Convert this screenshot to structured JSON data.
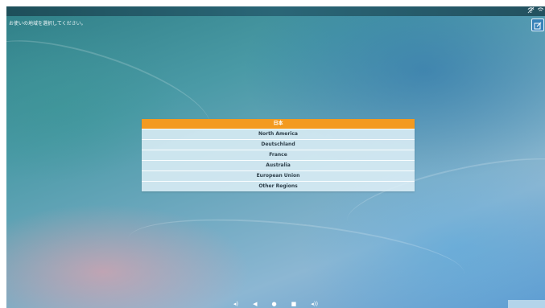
{
  "prompt_text": "お使いの地域を選択してください。",
  "status_bar": {
    "icons": [
      "wifi-off-icon",
      "wifi-icon"
    ]
  },
  "edit_button": {
    "icon": "edit-icon"
  },
  "regions": [
    {
      "label": "日本",
      "selected": true
    },
    {
      "label": "North America",
      "selected": false
    },
    {
      "label": "Deutschland",
      "selected": false
    },
    {
      "label": "France",
      "selected": false
    },
    {
      "label": "Australia",
      "selected": false
    },
    {
      "label": "European Union",
      "selected": false
    },
    {
      "label": "Other Regions",
      "selected": false
    }
  ],
  "nav_bar": {
    "buttons": [
      {
        "name": "volume-down",
        "glyph": "◂)"
      },
      {
        "name": "back",
        "glyph": "◀"
      },
      {
        "name": "home",
        "glyph": "●"
      },
      {
        "name": "recents",
        "glyph": "■"
      },
      {
        "name": "volume-up",
        "glyph": "◂))"
      }
    ]
  },
  "colors": {
    "selected": "#f39a20",
    "list_bg": "#dceef6"
  }
}
